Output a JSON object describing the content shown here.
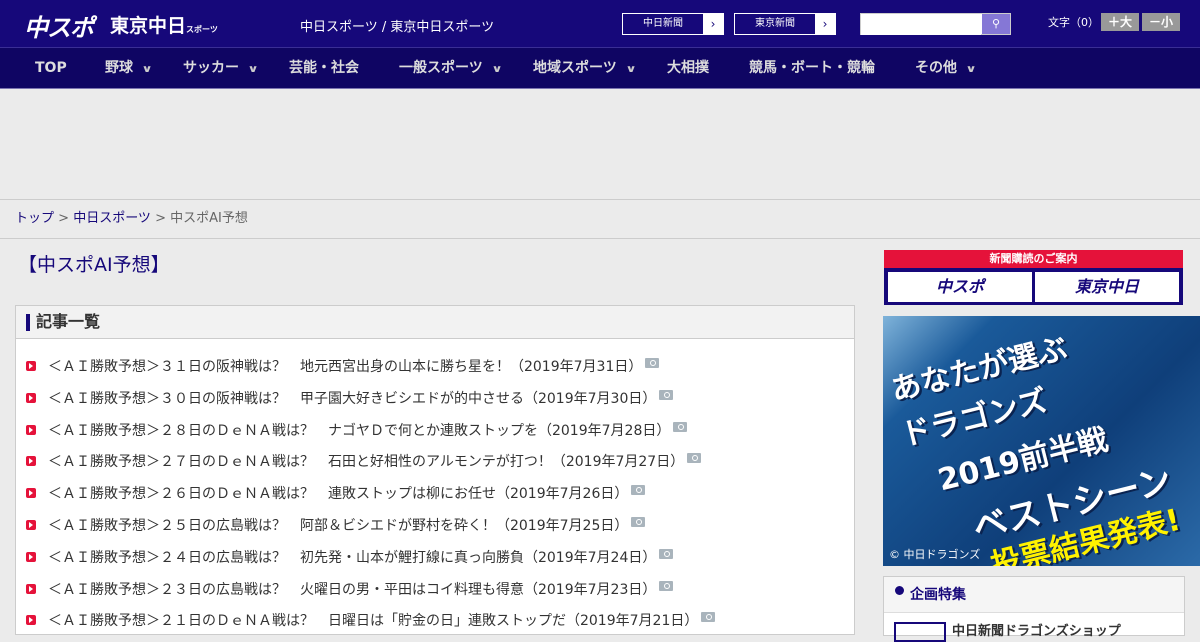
{
  "header": {
    "logo_chuspo": "中スポ",
    "logo_tokyo": "東京中日",
    "logo_tokyo_small": "スポーツ",
    "tagline": "中日スポーツ / 東京中日スポーツ",
    "btn_chunichi": "中日新聞",
    "btn_tokyo": "東京新聞",
    "search_placeholder": "",
    "font_label": "文字（0）",
    "font_up": "＋大",
    "font_down": "－小"
  },
  "nav": [
    {
      "label": "TOP"
    },
    {
      "label": "野球",
      "dd": "∨"
    },
    {
      "label": "サッカー",
      "dd": "∨"
    },
    {
      "label": "芸能・社会"
    },
    {
      "label": "一般スポーツ",
      "dd": "∨"
    },
    {
      "label": "地域スポーツ",
      "dd": "∨"
    },
    {
      "label": "大相撲"
    },
    {
      "label": "競馬・ボート・競輪"
    },
    {
      "label": "その他",
      "dd": "∨"
    }
  ],
  "breadcrumb": {
    "top": "トップ",
    "sep1": " > ",
    "section": "中日スポーツ",
    "sep2": " > ",
    "current": "中スポAI予想"
  },
  "page_title": "【中スポAI予想】",
  "list": {
    "heading": "記事一覧",
    "items": [
      "＜ＡＩ勝敗予想＞３１日の阪神戦は？　地元西宮出身の山本に勝ち星を！（2019年7月31日）",
      "＜ＡＩ勝敗予想＞３０日の阪神戦は？　甲子園大好きビシエドが的中させる（2019年7月30日）",
      "＜ＡＩ勝敗予想＞２８日のＤｅＮＡ戦は？　ナゴヤＤで何とか連敗ストップを（2019年7月28日）",
      "＜ＡＩ勝敗予想＞２７日のＤｅＮＡ戦は？　石田と好相性のアルモンテが打つ！（2019年7月27日）",
      "＜ＡＩ勝敗予想＞２６日のＤｅＮＡ戦は？　連敗ストップは柳にお任せ（2019年7月26日）",
      "＜ＡＩ勝敗予想＞２５日の広島戦は？　阿部＆ビシエドが野村を砕く！（2019年7月25日）",
      "＜ＡＩ勝敗予想＞２４日の広島戦は？　初先発・山本が鯉打線に真っ向勝負（2019年7月24日）",
      "＜ＡＩ勝敗予想＞２３日の広島戦は？　火曜日の男・平田はコイ料理も得意（2019年7月23日）",
      "＜ＡＩ勝敗予想＞２１日のＤｅＮＡ戦は？　日曜日は「貯金の日」連敗ストップだ（2019年7月21日）"
    ]
  },
  "sidebar": {
    "subscribe_title": "新聞購読のご案内",
    "subscribe_chuspo": "中スポ",
    "subscribe_tokyo": "東京中日",
    "promo": {
      "line1": "あなたが選ぶ",
      "line2": "ドラゴンズ",
      "line3": "2019前半戦",
      "line4": "ベストシーン",
      "line5": "投票結果発表!",
      "copyright": "© 中日ドラゴンズ"
    },
    "feature_heading": "企画特集",
    "feature_item": "中日新聞ドラゴンズショップ"
  }
}
